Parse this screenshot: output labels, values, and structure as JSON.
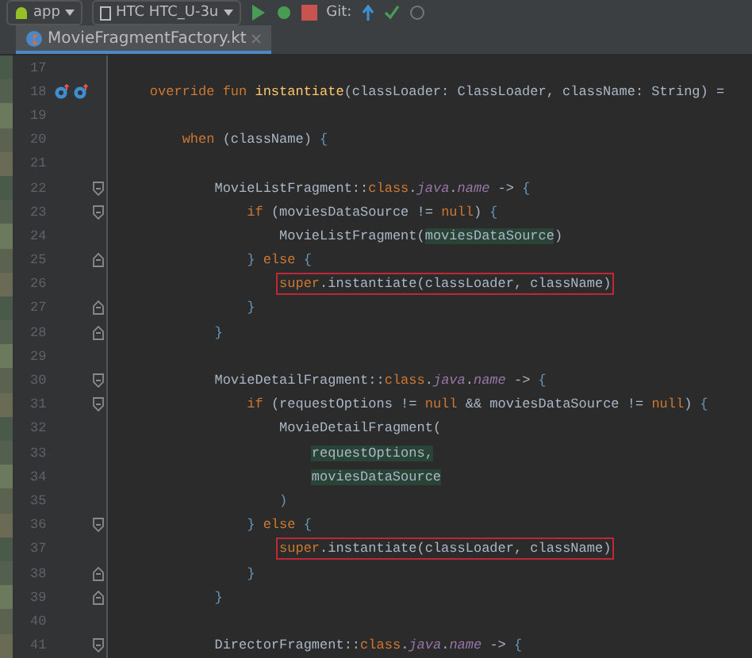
{
  "toolbar": {
    "config": "app",
    "device": "HTC HTC_U-3u",
    "vcs": "Git:"
  },
  "tabs": [
    {
      "label": "MovieFragmentFactory.kt",
      "selected": true
    }
  ],
  "lines": [
    {
      "n": "17"
    },
    {
      "n": "18",
      "gutter_icons": [
        {
          "kind": "override"
        },
        {
          "kind": "override"
        }
      ],
      "tokens": [
        {
          "t": "    override fun ",
          "kind": "kw"
        },
        {
          "t": "instantiate",
          "kind": "fn"
        },
        {
          "t": "(classLoader: ClassLoader, className: String) =",
          "kind": "plain"
        }
      ]
    },
    {
      "n": "19"
    },
    {
      "n": "20",
      "tokens": [
        {
          "t": "        when ",
          "kind": "kw"
        },
        {
          "t": "(className) ",
          "kind": "plain"
        },
        {
          "t": "{",
          "kind": "brace"
        }
      ]
    },
    {
      "n": "21"
    },
    {
      "n": "22",
      "fold_start": true,
      "tokens": [
        {
          "t": "            MovieListFragment::",
          "kind": "plain"
        },
        {
          "t": "class",
          "kind": "kw"
        },
        {
          "t": ".",
          "kind": "plain"
        },
        {
          "t": "java",
          "kind": "prop"
        },
        {
          "t": ".",
          "kind": "plain"
        },
        {
          "t": "name",
          "kind": "prop"
        },
        {
          "t": " -> ",
          "kind": "plain"
        },
        {
          "t": "{",
          "kind": "brace"
        }
      ]
    },
    {
      "n": "23",
      "fold_start": true,
      "tokens": [
        {
          "t": "                if ",
          "kind": "kw"
        },
        {
          "t": "(moviesDataSource != ",
          "kind": "plain"
        },
        {
          "t": "null",
          "kind": "kw"
        },
        {
          "t": ") ",
          "kind": "plain"
        },
        {
          "t": "{",
          "kind": "brace"
        }
      ]
    },
    {
      "n": "24",
      "tokens": [
        {
          "t": "                    MovieListFragment(",
          "kind": "plain"
        },
        {
          "t": "moviesDataSource",
          "kind": "arg"
        },
        {
          "t": ")",
          "kind": "plain"
        }
      ]
    },
    {
      "n": "25",
      "fold_end": true,
      "tokens": [
        {
          "t": "                } ",
          "kind": "brace"
        },
        {
          "t": "else ",
          "kind": "kw"
        },
        {
          "t": "{",
          "kind": "brace"
        }
      ]
    },
    {
      "n": "26",
      "boxed": true,
      "tokens": [
        {
          "t": "                    super",
          "kind": "kw"
        },
        {
          "t": ".instantiate(classLoader, className)",
          "kind": "plain"
        }
      ]
    },
    {
      "n": "27",
      "fold_end": true,
      "tokens": [
        {
          "t": "                }",
          "kind": "brace"
        }
      ]
    },
    {
      "n": "28",
      "fold_end": true,
      "tokens": [
        {
          "t": "            }",
          "kind": "brace"
        }
      ]
    },
    {
      "n": "29"
    },
    {
      "n": "30",
      "fold_start": true,
      "tokens": [
        {
          "t": "            MovieDetailFragment::",
          "kind": "plain"
        },
        {
          "t": "class",
          "kind": "kw"
        },
        {
          "t": ".",
          "kind": "plain"
        },
        {
          "t": "java",
          "kind": "prop"
        },
        {
          "t": ".",
          "kind": "plain"
        },
        {
          "t": "name",
          "kind": "prop"
        },
        {
          "t": " -> ",
          "kind": "plain"
        },
        {
          "t": "{",
          "kind": "brace"
        }
      ]
    },
    {
      "n": "31",
      "fold_start": true,
      "tokens": [
        {
          "t": "                if ",
          "kind": "kw"
        },
        {
          "t": "(requestOptions != ",
          "kind": "plain"
        },
        {
          "t": "null",
          "kind": "kw"
        },
        {
          "t": " && moviesDataSource != ",
          "kind": "plain"
        },
        {
          "t": "null",
          "kind": "kw"
        },
        {
          "t": ") ",
          "kind": "plain"
        },
        {
          "t": "{",
          "kind": "brace"
        }
      ]
    },
    {
      "n": "32",
      "tokens": [
        {
          "t": "                    MovieDetailFragment(",
          "kind": "plain"
        }
      ]
    },
    {
      "n": "33",
      "tokens": [
        {
          "t": "                        requestOptions,",
          "kind": "arg"
        }
      ]
    },
    {
      "n": "34",
      "tokens": [
        {
          "t": "                        moviesDataSource",
          "kind": "arg"
        }
      ]
    },
    {
      "n": "35",
      "tokens": [
        {
          "t": "                    )",
          "kind": "brace"
        }
      ]
    },
    {
      "n": "36",
      "fold_start": true,
      "tokens": [
        {
          "t": "                } ",
          "kind": "brace"
        },
        {
          "t": "else ",
          "kind": "kw"
        },
        {
          "t": "{",
          "kind": "brace"
        }
      ]
    },
    {
      "n": "37",
      "boxed": true,
      "tokens": [
        {
          "t": "                    super",
          "kind": "kw"
        },
        {
          "t": ".instantiate(classLoader, className)",
          "kind": "plain"
        }
      ]
    },
    {
      "n": "38",
      "fold_end": true,
      "tokens": [
        {
          "t": "                }",
          "kind": "brace"
        }
      ]
    },
    {
      "n": "39",
      "fold_end": true,
      "tokens": [
        {
          "t": "            }",
          "kind": "brace"
        }
      ]
    },
    {
      "n": "40"
    },
    {
      "n": "41",
      "fold_start": true,
      "tokens": [
        {
          "t": "            DirectorFragment::",
          "kind": "plain"
        },
        {
          "t": "class",
          "kind": "kw"
        },
        {
          "t": ".",
          "kind": "plain"
        },
        {
          "t": "java",
          "kind": "prop"
        },
        {
          "t": ".",
          "kind": "plain"
        },
        {
          "t": "name",
          "kind": "prop"
        },
        {
          "t": " -> ",
          "kind": "plain"
        },
        {
          "t": "{",
          "kind": "brace"
        }
      ]
    }
  ]
}
